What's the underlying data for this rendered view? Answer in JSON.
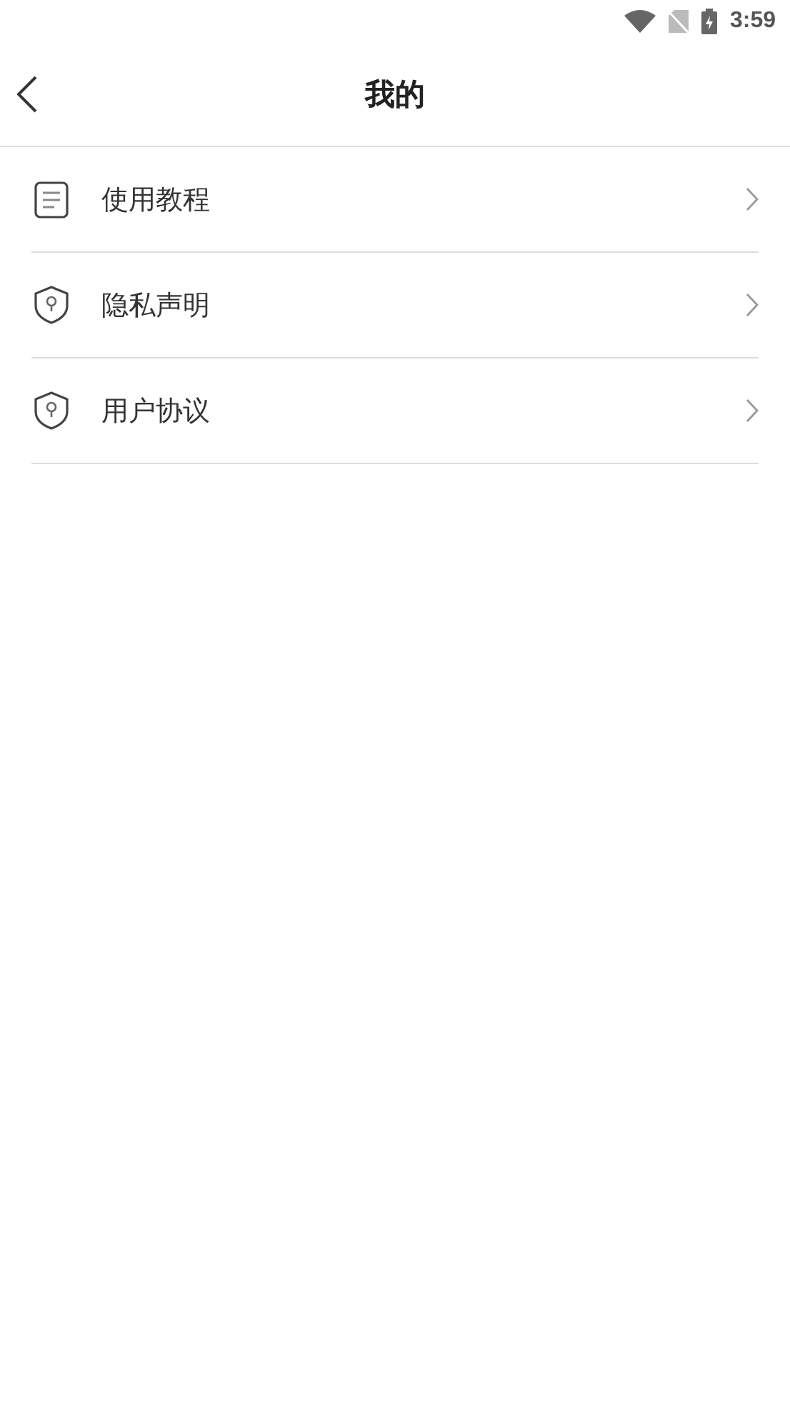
{
  "status_bar": {
    "time": "3:59"
  },
  "header": {
    "title": "我的"
  },
  "menu": [
    {
      "label": "使用教程",
      "kind": "document"
    },
    {
      "label": "隐私声明",
      "kind": "shield"
    },
    {
      "label": "用户协议",
      "kind": "shield"
    }
  ]
}
